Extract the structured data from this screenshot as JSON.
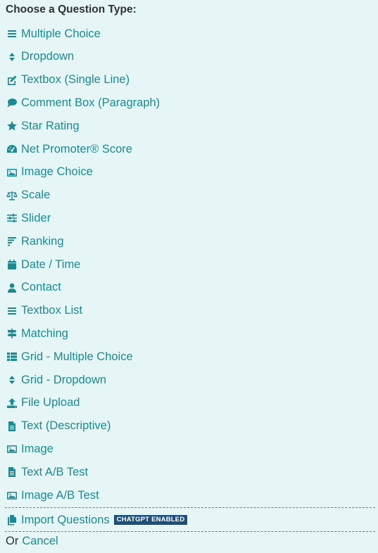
{
  "heading": "Choose a Question Type:",
  "accent_color": "#1b8a92",
  "question_types": [
    {
      "label": "Multiple Choice",
      "icon": "list-icon"
    },
    {
      "label": "Dropdown",
      "icon": "sort-icon"
    },
    {
      "label": "Textbox (Single Line)",
      "icon": "edit-icon"
    },
    {
      "label": "Comment Box (Paragraph)",
      "icon": "comment-icon"
    },
    {
      "label": "Star Rating",
      "icon": "star-icon"
    },
    {
      "label": "Net Promoter® Score",
      "icon": "gauge-icon"
    },
    {
      "label": "Image Choice",
      "icon": "image-icon"
    },
    {
      "label": "Scale",
      "icon": "balance-scale-icon"
    },
    {
      "label": "Slider",
      "icon": "sliders-icon"
    },
    {
      "label": "Ranking",
      "icon": "ranking-icon"
    },
    {
      "label": "Date / Time",
      "icon": "calendar-icon"
    },
    {
      "label": "Contact",
      "icon": "user-icon"
    },
    {
      "label": "Textbox List",
      "icon": "list-icon"
    },
    {
      "label": "Matching",
      "icon": "signs-icon"
    },
    {
      "label": "Grid - Multiple Choice",
      "icon": "grid-list-icon"
    },
    {
      "label": "Grid - Dropdown",
      "icon": "sort-icon"
    },
    {
      "label": "File Upload",
      "icon": "upload-icon"
    },
    {
      "label": "Text (Descriptive)",
      "icon": "file-text-icon"
    },
    {
      "label": "Image",
      "icon": "image-icon"
    },
    {
      "label": "Text A/B Test",
      "icon": "file-text-icon"
    },
    {
      "label": "Image A/B Test",
      "icon": "image-icon"
    }
  ],
  "import": {
    "label": "Import Questions",
    "icon": "copy-icon",
    "badge": "CHATGPT ENABLED",
    "badge_color": "#1d4f78"
  },
  "footer": {
    "or_text": "Or",
    "cancel_label": "Cancel"
  }
}
